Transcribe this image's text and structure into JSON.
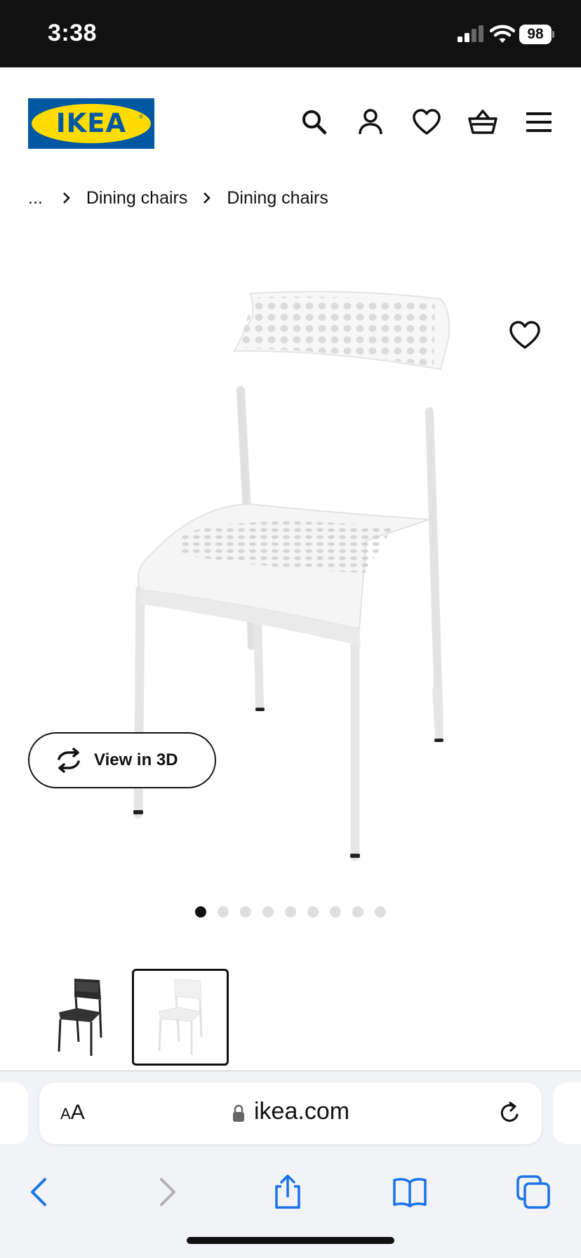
{
  "status_bar": {
    "time": "3:38",
    "battery": "98"
  },
  "header": {
    "logo_text": "IKEA",
    "icons": [
      "search-icon",
      "account-icon",
      "heart-icon",
      "basket-icon",
      "menu-icon"
    ]
  },
  "breadcrumb": {
    "ellipsis": "...",
    "items": [
      "Dining chairs",
      "Dining chairs"
    ]
  },
  "gallery": {
    "view3d_label": "View in 3D",
    "image_count": 9,
    "active_index": 0,
    "thumbnails": [
      "black chair",
      "white chair"
    ],
    "selected_thumbnail": 1
  },
  "browser": {
    "aa_small": "A",
    "aa_large": "A",
    "url": "ikea.com"
  },
  "colors": {
    "ikea_blue": "#0058a3",
    "ikea_yellow": "#ffdb00",
    "safari_blue": "#1a73e8"
  }
}
